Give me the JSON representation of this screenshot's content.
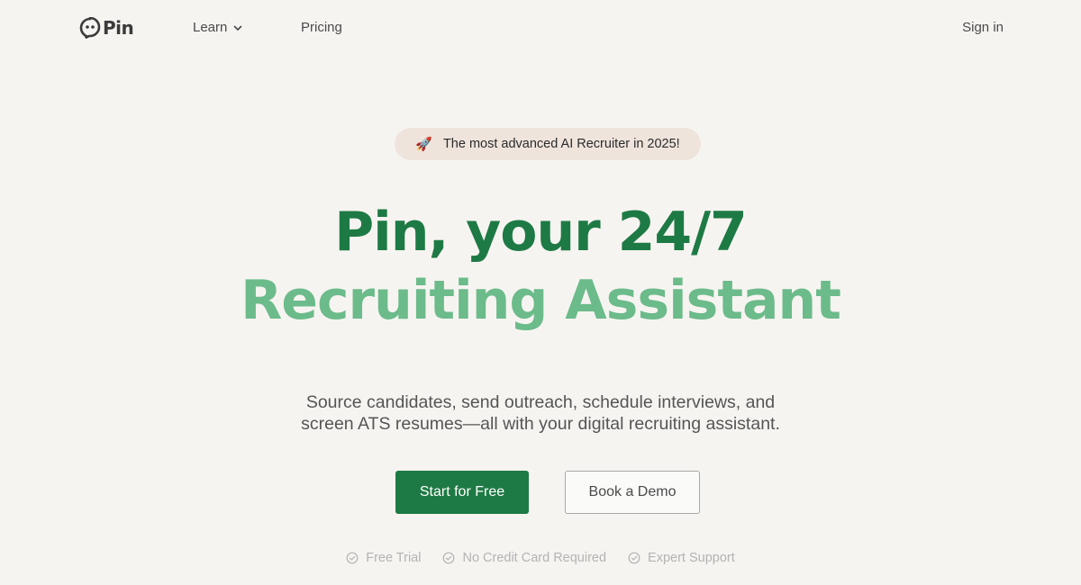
{
  "nav": {
    "logo_text": "Pin",
    "learn_label": "Learn",
    "pricing_label": "Pricing",
    "signin_label": "Sign in"
  },
  "badge": {
    "icon": "rocket-icon",
    "text": "The most advanced AI Recruiter in 2025!"
  },
  "hero": {
    "line1": "Pin, your 24/7",
    "line2": "Recruiting Assistant"
  },
  "subtitle": {
    "line1": "Source candidates, send outreach, schedule interviews, and",
    "line2": "screen ATS resumes—all with your digital recruiting assistant."
  },
  "cta": {
    "primary": "Start for Free",
    "secondary": "Book a Demo"
  },
  "features": [
    "Free Trial",
    "No Credit Card Required",
    "Expert Support"
  ],
  "colors": {
    "background": "#f6f4f1",
    "primary_green": "#1e7a44",
    "light_green": "#6cbb8a",
    "badge_bg": "#efe4dc"
  }
}
